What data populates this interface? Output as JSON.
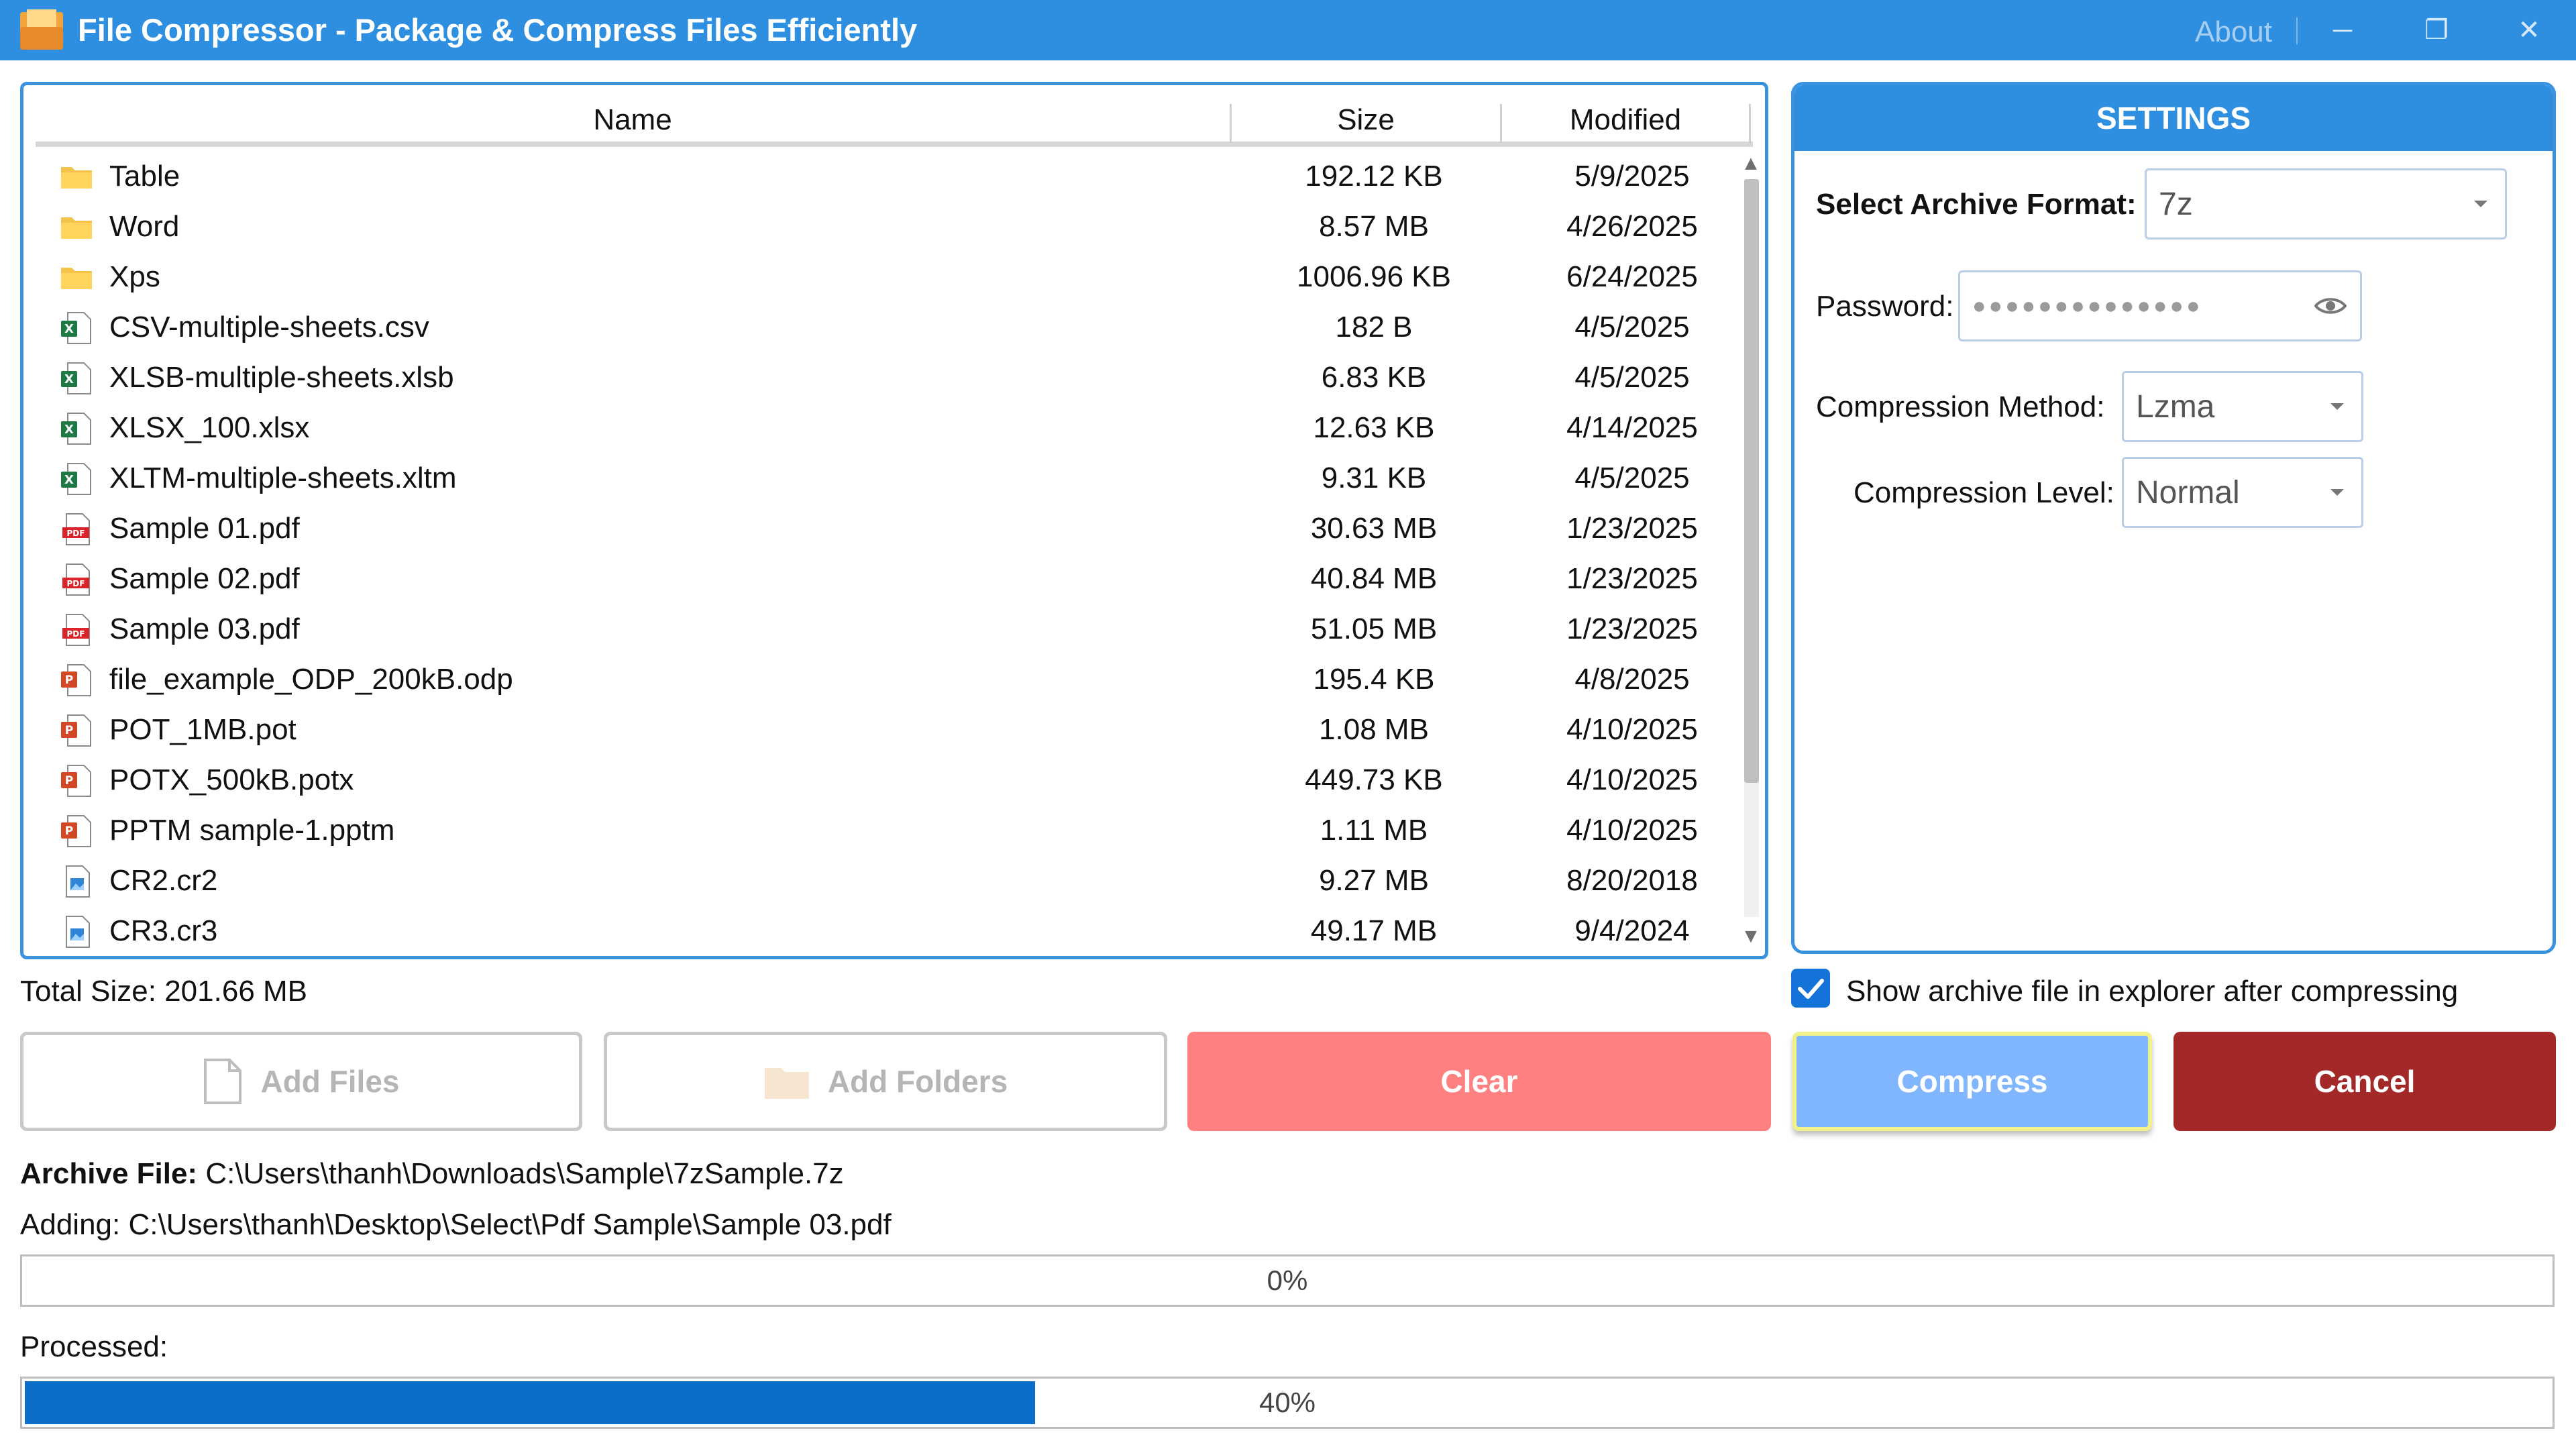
{
  "window": {
    "title": "File Compressor - Package & Compress Files Efficiently",
    "about_label": "About",
    "minimize": "─",
    "restore": "❐",
    "close": "✕"
  },
  "file_list": {
    "columns": {
      "name": "Name",
      "size": "Size",
      "modified": "Modified"
    },
    "rows": [
      {
        "name": "Table",
        "size": "192.12 KB",
        "modified": "5/9/2025",
        "icon": "folder-icon"
      },
      {
        "name": "Word",
        "size": "8.57 MB",
        "modified": "4/26/2025",
        "icon": "folder-icon"
      },
      {
        "name": "Xps",
        "size": "1006.96 KB",
        "modified": "6/24/2025",
        "icon": "folder-icon"
      },
      {
        "name": "CSV-multiple-sheets.csv",
        "size": "182 B",
        "modified": "4/5/2025",
        "icon": "excel-file-icon"
      },
      {
        "name": "XLSB-multiple-sheets.xlsb",
        "size": "6.83 KB",
        "modified": "4/5/2025",
        "icon": "excel-file-icon"
      },
      {
        "name": "XLSX_100.xlsx",
        "size": "12.63 KB",
        "modified": "4/14/2025",
        "icon": "excel-file-icon"
      },
      {
        "name": "XLTM-multiple-sheets.xltm",
        "size": "9.31 KB",
        "modified": "4/5/2025",
        "icon": "excel-file-icon"
      },
      {
        "name": "Sample 01.pdf",
        "size": "30.63 MB",
        "modified": "1/23/2025",
        "icon": "pdf-file-icon"
      },
      {
        "name": "Sample 02.pdf",
        "size": "40.84 MB",
        "modified": "1/23/2025",
        "icon": "pdf-file-icon"
      },
      {
        "name": "Sample 03.pdf",
        "size": "51.05 MB",
        "modified": "1/23/2025",
        "icon": "pdf-file-icon"
      },
      {
        "name": "file_example_ODP_200kB.odp",
        "size": "195.4 KB",
        "modified": "4/8/2025",
        "icon": "powerpoint-file-icon"
      },
      {
        "name": "POT_1MB.pot",
        "size": "1.08 MB",
        "modified": "4/10/2025",
        "icon": "powerpoint-file-icon"
      },
      {
        "name": "POTX_500kB.potx",
        "size": "449.73 KB",
        "modified": "4/10/2025",
        "icon": "powerpoint-file-icon"
      },
      {
        "name": "PPTM sample-1.pptm",
        "size": "1.11 MB",
        "modified": "4/10/2025",
        "icon": "powerpoint-file-icon"
      },
      {
        "name": "CR2.cr2",
        "size": "9.27 MB",
        "modified": "8/20/2018",
        "icon": "image-file-icon"
      },
      {
        "name": "CR3.cr3",
        "size": "49.17 MB",
        "modified": "9/4/2024",
        "icon": "image-file-icon"
      }
    ],
    "total_size": "Total Size: 201.66 MB"
  },
  "settings": {
    "header": "SETTINGS",
    "archive_format_label": "Select Archive Format:",
    "archive_format_value": "7z",
    "password_label": "Password:",
    "password_mask": "●●●●●●●●●●●●●●",
    "compression_method_label": "Compression Method:",
    "compression_method_value": "Lzma",
    "compression_level_label": "Compression Level:",
    "compression_level_value": "Normal"
  },
  "options": {
    "show_in_explorer_label": "Show archive file in explorer after compressing",
    "show_in_explorer_checked": true
  },
  "buttons": {
    "add_files": "Add Files",
    "add_folders": "Add Folders",
    "clear": "Clear",
    "compress": "Compress",
    "cancel": "Cancel"
  },
  "status": {
    "archive_file_label": "Archive File:",
    "archive_file_path": "C:\\Users\\thanh\\Downloads\\Sample\\7zSample.7z",
    "adding_label": "Adding:",
    "adding_path": "C:\\Users\\thanh\\Desktop\\Select\\Pdf Sample\\Sample 03.pdf",
    "current_progress_text": "0%",
    "current_progress_value": 0,
    "processed_label": "Processed:",
    "processed_progress_text": "40%",
    "processed_progress_value": 0.4
  },
  "colors": {
    "accent": "#2e8fe0",
    "clear": "#ff8080",
    "compress": "#80b6ff",
    "cancel": "#a32929",
    "progress_fill": "#0b6fc9"
  }
}
